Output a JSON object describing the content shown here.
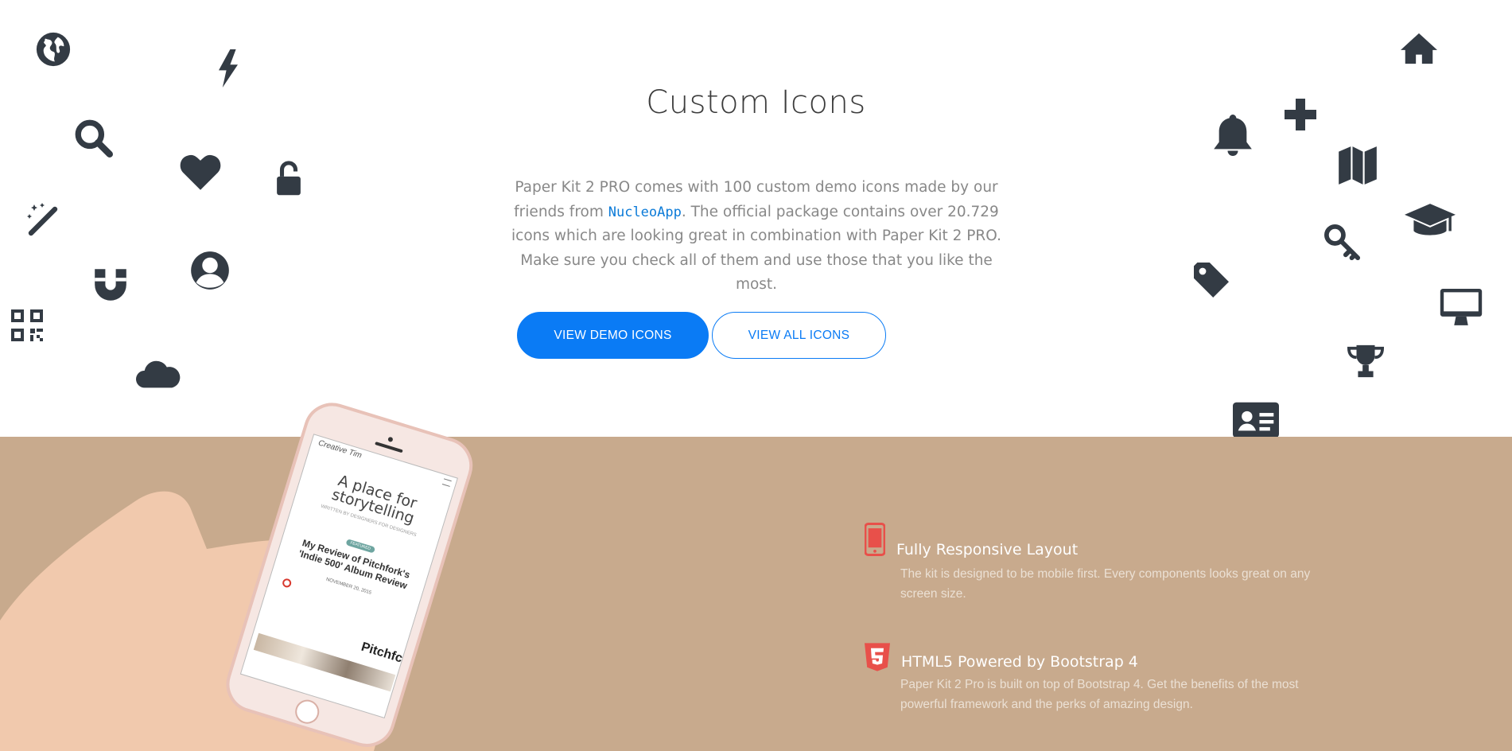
{
  "section": {
    "title": "Custom Icons",
    "description_parts": {
      "before": "Paper Kit 2 PRO comes with 100 custom demo icons made by our friends from ",
      "link": "NucleoApp",
      "after": ". The official package contains over 20.729 icons which are looking great in combination with Paper Kit 2 PRO. Make sure you check all of them and use those that you like the most."
    },
    "buttons": {
      "demo": "VIEW DEMO ICONS",
      "all": "VIEW ALL ICONS"
    }
  },
  "colors": {
    "accent": "#0a7bf5",
    "icon": "#333b44",
    "band": "#c8aa8d",
    "feature_icon": "#e8504a"
  },
  "floating_icons_left": [
    "globe-icon",
    "lightning-icon",
    "search-icon",
    "heart-icon",
    "unlock-icon",
    "magic-wand-icon",
    "magnet-icon",
    "user-circle-icon",
    "qr-code-icon",
    "cloud-icon"
  ],
  "floating_icons_right": [
    "home-icon",
    "plus-icon",
    "bell-icon",
    "map-icon",
    "graduation-cap-icon",
    "key-icon",
    "tag-icon",
    "monitor-icon",
    "trophy-icon",
    "id-card-icon"
  ],
  "phone": {
    "brand": "Creative Tim",
    "headline": "A place for storytelling",
    "subline": "WRITTEN BY DESIGNERS FOR DESIGNERS",
    "badge": "FEATURED",
    "article": "My Review of Pitchfork's 'Indie 500' Album Review",
    "date": "NOVEMBER 20, 2015",
    "footer_brand": "Pitchfc"
  },
  "features": [
    {
      "icon": "mobile-phone-icon",
      "title": "Fully Responsive Layout",
      "text": "The kit is designed to be mobile first. Every components looks great on any screen size."
    },
    {
      "icon": "html5-icon",
      "title": "HTML5 Powered by Bootstrap 4",
      "text": "Paper Kit 2 Pro is built on top of Bootstrap 4. Get the benefits of the most powerful framework and the perks of amazing design."
    }
  ]
}
